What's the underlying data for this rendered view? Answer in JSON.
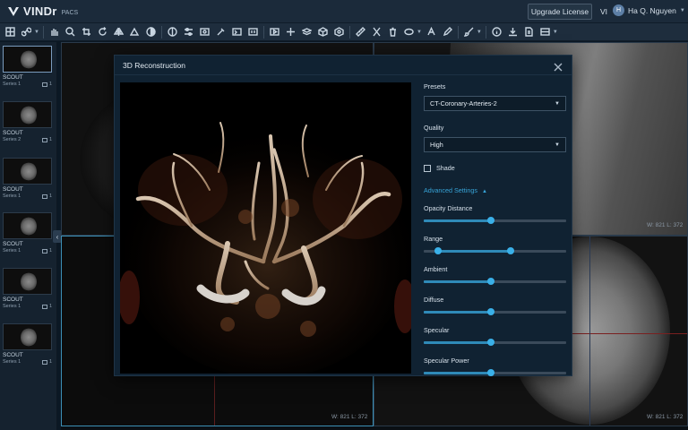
{
  "app": {
    "logo_text": "VINDr",
    "logo_sub": "PACS",
    "upgrade_label": "Upgrade License",
    "language": "VI",
    "user_name": "Ha Q. Nguyen",
    "user_initial": "H"
  },
  "toolbar": {
    "icons": [
      "layout-icon",
      "link-icon",
      "pan-icon",
      "zoom-icon",
      "crop-icon",
      "rotate-icon",
      "flip-icon",
      "window-level-icon",
      "invert-icon",
      "contrast-icon",
      "sliders-icon",
      "image-icon",
      "eyedropper-icon",
      "screen-icon",
      "layers-icon",
      "play-icon",
      "crosshair-icon",
      "stack-icon",
      "cube-icon",
      "volume-icon",
      "ruler-icon",
      "angle-icon",
      "trash-icon",
      "ellipse-icon",
      "text-annotation-icon",
      "pen-icon",
      "brush-icon",
      "info-icon",
      "download-icon",
      "document-icon",
      "grid-icon"
    ]
  },
  "sidebar": {
    "series": [
      {
        "name": "SCOUT",
        "series": "Series 1",
        "count": "1"
      },
      {
        "name": "SCOUT",
        "series": "Series 2",
        "count": "1"
      },
      {
        "name": "SCOUT",
        "series": "Series 1",
        "count": "1"
      },
      {
        "name": "SCOUT",
        "series": "Series 1",
        "count": "1"
      },
      {
        "name": "SCOUT",
        "series": "Series 1",
        "count": "1"
      },
      {
        "name": "SCOUT",
        "series": "Series 1",
        "count": "1"
      }
    ]
  },
  "viewports": {
    "wl_top_right": "W: 821 L: 372",
    "wl_bottom_left": "W: 821 L: 372",
    "wl_bottom_right": "W: 821 L: 372"
  },
  "modal": {
    "title": "3D Reconstruction",
    "presets_label": "Presets",
    "preset_value": "CT-Coronary-Arteries-2",
    "quality_label": "Quality",
    "quality_value": "High",
    "shade_label": "Shade",
    "shade_checked": false,
    "advanced_label": "Advanced Settings",
    "sliders": [
      {
        "label": "Opacity Distance",
        "value": 0.47
      },
      {
        "label": "Range",
        "low": 0.1,
        "high": 0.61
      },
      {
        "label": "Ambient",
        "value": 0.47
      },
      {
        "label": "Diffuse",
        "value": 0.47
      },
      {
        "label": "Specular",
        "value": 0.47
      },
      {
        "label": "Specular Power",
        "value": 0.47
      }
    ]
  },
  "colors": {
    "accent": "#37a4d8",
    "slider_fill": "#2f8ab8",
    "modal_bg": "#102232"
  }
}
